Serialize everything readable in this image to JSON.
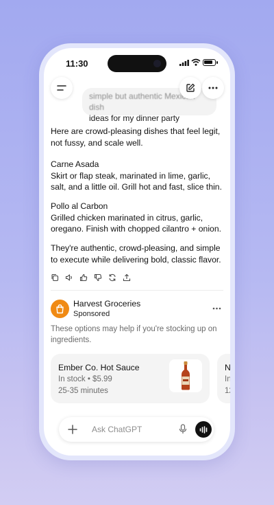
{
  "status_bar": {
    "time": "11:30"
  },
  "chat": {
    "user_message_line1": "simple but authentic Mexican dish",
    "user_message_line2": "ideas for my dinner party",
    "reply": {
      "intro": "Here are crowd-pleasing dishes that feel legit, not fussy, and scale well.",
      "dish1_title": "Carne Asada",
      "dish1_desc": "Skirt or flap steak, marinated in lime, garlic, salt, and a little oil. Grill hot and fast, slice thin.",
      "dish2_title": "Pollo al Carbon",
      "dish2_desc": "Grilled chicken marinated in citrus, garlic, oregano. Finish with chopped cilantro + onion.",
      "closing": "They're authentic, crowd-pleasing, and simple to execute while delivering bold, classic flavor."
    }
  },
  "sponsor": {
    "name": "Harvest Groceries",
    "label": "Sponsored",
    "text": "These options may help if you're stocking up on ingredients.",
    "brand_color": "#f08a14"
  },
  "products": [
    {
      "title": "Ember Co. Hot Sauce",
      "stock": "In stock • $5.99",
      "eta": "25-35 minutes"
    },
    {
      "title": "N",
      "stock": "In",
      "eta": "12"
    }
  ],
  "composer": {
    "placeholder": "Ask ChatGPT"
  },
  "icons": [
    "menu-icon",
    "edit-icon",
    "more-icon",
    "copy-icon",
    "speaker-icon",
    "thumbs-up-icon",
    "thumbs-down-icon",
    "regenerate-icon",
    "share-icon",
    "shopping-bag-icon",
    "plus-icon",
    "mic-icon",
    "voice-icon"
  ]
}
